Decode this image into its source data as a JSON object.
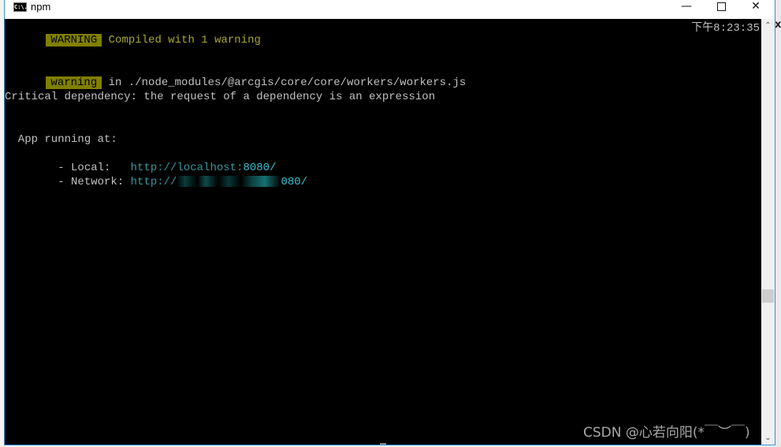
{
  "window": {
    "title": "npm",
    "icon": "cmd-icon",
    "icon_label": "C:\\.",
    "controls": {
      "minimize": "—",
      "maximize": "□",
      "close": "✕"
    }
  },
  "console": {
    "time": "下午8:23:35",
    "header_badge": "WARNING",
    "header_message": "Compiled with 1 warning",
    "warning_badge": "warning",
    "warning_location": " in ./node_modules/@arcgis/core/core/workers/workers.js",
    "critical_message": "Critical dependency: the request of a dependency is an expression",
    "app_running": "  App running at:",
    "local_label": "  - Local:   ",
    "local_url_prefix": "http://localhost:",
    "local_url_port": "8080/",
    "network_label": "  - Network: ",
    "network_url_prefix": "http://",
    "network_url_suffix": "080/"
  },
  "background_window": {
    "close_glyph": "x"
  },
  "scrollbar": {
    "up": "⌃",
    "down": "⌄",
    "position_fraction": 0.66
  },
  "watermark": "CSDN @心若向阳(*￣︶￣)"
}
